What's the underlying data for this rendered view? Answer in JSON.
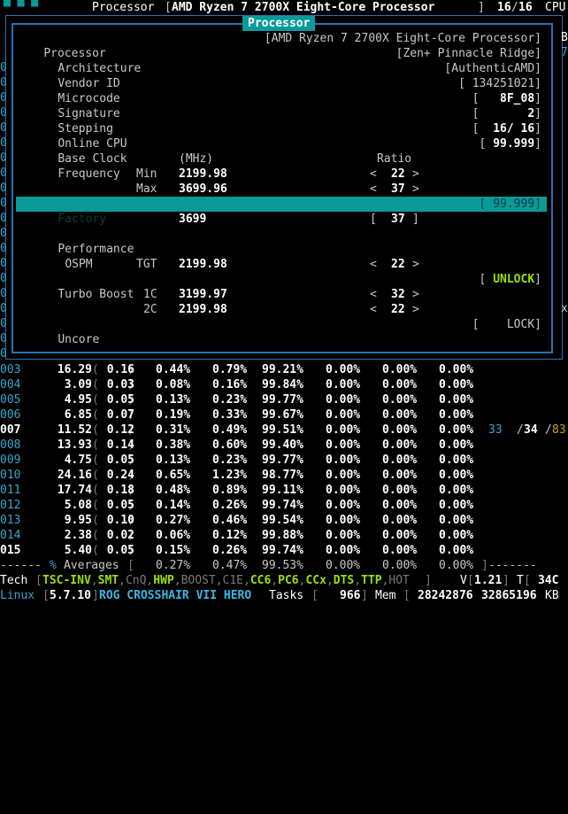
{
  "topbar": {
    "label": "Processor",
    "processor": "AMD Ryzen 7 2700X Eight-Core Processor",
    "cpus": "16",
    "cpus_total": "16",
    "cpu_label": "CPU",
    "left_fragment": "▀ ▀ ▀"
  },
  "popup": {
    "title": "Processor",
    "processor_label": "Processor",
    "processor_value": "[AMD Ryzen 7 2700X Eight-Core Processor]",
    "architecture_label": "Architecture",
    "architecture_value": "[Zen+ Pinnacle Ridge]",
    "vendor_label": "Vendor ID",
    "vendor_value": "[AuthenticAMD]",
    "microcode_label": "Microcode",
    "microcode_value": "[ 134251021]",
    "signature_label": "Signature",
    "signature_value": "8F_08",
    "stepping_label": "Stepping",
    "stepping_value": "2",
    "online_label": "Online CPU",
    "online_value": "16/ 16",
    "baseclock_label": "Base Clock",
    "baseclock_value": "99.999",
    "frequency_label": "Frequency",
    "mhz_label": "(MHz)",
    "ratio_label": "Ratio",
    "min_label": "Min",
    "min_mhz": "2199.98",
    "min_ratio": "22",
    "max_label": "Max",
    "max_mhz": "3699.96",
    "max_ratio": "37",
    "factory_label": "Factory",
    "factory_value": "[ 99.999]",
    "factory_mhz": "3699",
    "factory_ratio": "37",
    "performance_label": "Performance",
    "ospm_label": "OSPM",
    "tgt_label": "TGT",
    "tgt_mhz": "2199.98",
    "tgt_ratio": "22",
    "turbo_label": "Turbo Boost",
    "turbo_value": "UNLOCK",
    "c1_label": "1C",
    "c1_mhz": "3199.97",
    "c1_ratio": "32",
    "c2_label": "2C",
    "c2_mhz": "2199.98",
    "c2_ratio": "22",
    "uncore_label": "Uncore",
    "uncore_value": "LOCK"
  },
  "side": {
    "right_b": "B",
    "right_7": "7",
    "right_x": "x"
  },
  "rows": [
    {
      "id": "003",
      "a": "16.29",
      "b": "0.16",
      "c": "0.44%",
      "d": "0.79%",
      "e": "99.21%",
      "f": "0.00%",
      "g": "0.00%",
      "h": "0.00%"
    },
    {
      "id": "004",
      "a": "3.09",
      "b": "0.03",
      "c": "0.08%",
      "d": "0.16%",
      "e": "99.84%",
      "f": "0.00%",
      "g": "0.00%",
      "h": "0.00%"
    },
    {
      "id": "005",
      "a": "4.95",
      "b": "0.05",
      "c": "0.13%",
      "d": "0.23%",
      "e": "99.77%",
      "f": "0.00%",
      "g": "0.00%",
      "h": "0.00%"
    },
    {
      "id": "006",
      "a": "6.85",
      "b": "0.07",
      "c": "0.19%",
      "d": "0.33%",
      "e": "99.67%",
      "f": "0.00%",
      "g": "0.00%",
      "h": "0.00%"
    },
    {
      "id": "007",
      "a": "11.52",
      "b": "0.12",
      "c": "0.31%",
      "d": "0.49%",
      "e": "99.51%",
      "f": "0.00%",
      "g": "0.00%",
      "h": "0.00%"
    },
    {
      "id": "008",
      "a": "13.93",
      "b": "0.14",
      "c": "0.38%",
      "d": "0.60%",
      "e": "99.40%",
      "f": "0.00%",
      "g": "0.00%",
      "h": "0.00%"
    },
    {
      "id": "009",
      "a": "4.75",
      "b": "0.05",
      "c": "0.13%",
      "d": "0.23%",
      "e": "99.77%",
      "f": "0.00%",
      "g": "0.00%",
      "h": "0.00%"
    },
    {
      "id": "010",
      "a": "24.16",
      "b": "0.24",
      "c": "0.65%",
      "d": "1.23%",
      "e": "98.77%",
      "f": "0.00%",
      "g": "0.00%",
      "h": "0.00%"
    },
    {
      "id": "011",
      "a": "17.74",
      "b": "0.18",
      "c": "0.48%",
      "d": "0.89%",
      "e": "99.11%",
      "f": "0.00%",
      "g": "0.00%",
      "h": "0.00%"
    },
    {
      "id": "012",
      "a": "5.08",
      "b": "0.05",
      "c": "0.14%",
      "d": "0.26%",
      "e": "99.74%",
      "f": "0.00%",
      "g": "0.00%",
      "h": "0.00%"
    },
    {
      "id": "013",
      "a": "9.95",
      "b": "0.10",
      "c": "0.27%",
      "d": "0.46%",
      "e": "99.54%",
      "f": "0.00%",
      "g": "0.00%",
      "h": "0.00%"
    },
    {
      "id": "014",
      "a": "2.38",
      "b": "0.02",
      "c": "0.06%",
      "d": "0.12%",
      "e": "99.88%",
      "f": "0.00%",
      "g": "0.00%",
      "h": "0.00%"
    },
    {
      "id": "015",
      "a": "5.40",
      "b": "0.05",
      "c": "0.15%",
      "d": "0.26%",
      "e": "99.74%",
      "f": "0.00%",
      "g": "0.00%",
      "h": "0.00%"
    }
  ],
  "row007_extra": {
    "temp_min": "33",
    "sep": "/",
    "temp_cur": "34",
    "sep2": "/",
    "temp_max": "83"
  },
  "averages": {
    "dashes_left": "------",
    "percent": "%",
    "label": "Averages",
    "c": "0.27%",
    "d": "0.47%",
    "e": "99.53%",
    "f": "0.00%",
    "g": "0.00%",
    "h": "0.00%",
    "dashes_right": "-------"
  },
  "tech": {
    "label": "Tech",
    "items": [
      "TSC-INV",
      "SMT",
      "CnQ",
      "HWP",
      "BOOST",
      "C1E",
      "CC6",
      "PC6",
      "CCx",
      "DTS",
      "TTP",
      "HOT"
    ],
    "v_label": "V",
    "v_value": "1.21",
    "t_label": "T",
    "t_value": "34C"
  },
  "linux": {
    "label": "Linux",
    "kernel": "5.7.10",
    "board": "ROG CROSSHAIR VII HERO",
    "tasks_label": "Tasks",
    "tasks_value": "966",
    "mem_label": "Mem",
    "mem_used": "28242876",
    "mem_total": "32865196",
    "mem_unit": "KB"
  }
}
